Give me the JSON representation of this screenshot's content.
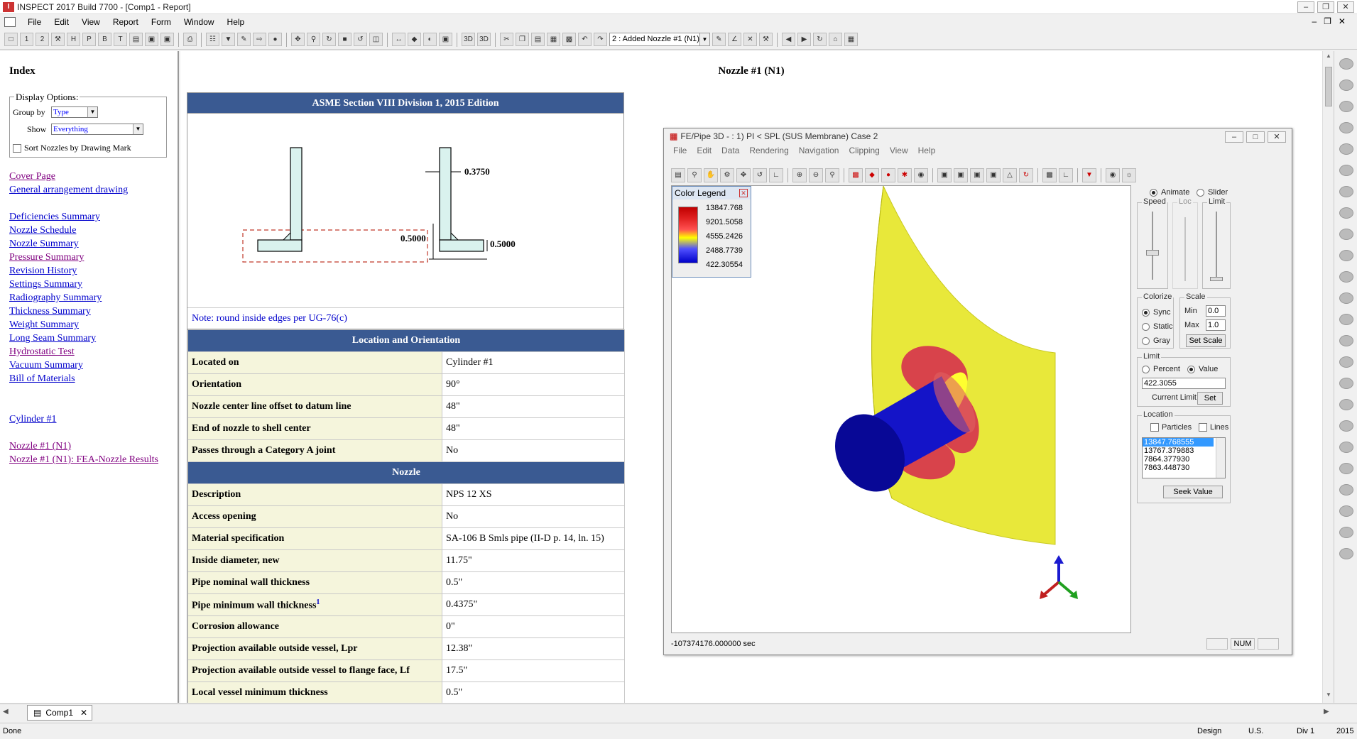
{
  "app": {
    "title": "INSPECT 2017 Build 7700 - [Comp1 - Report]",
    "menu": [
      "File",
      "Edit",
      "View",
      "Report",
      "Form",
      "Window",
      "Help"
    ],
    "history_combo": "2 : Added Nozzle #1 (N1)",
    "toolbar_3d_a": "3D",
    "toolbar_3d_b": "3D"
  },
  "sidebar": {
    "heading": "Index",
    "display_options": "Display Options:",
    "group_by_label": "Group by",
    "group_by_value": "Type",
    "show_label": "Show",
    "show_value": "Everything",
    "sort_label": "Sort Nozzles by Drawing Mark",
    "links": [
      "Cover Page",
      "General arrangement drawing",
      "Deficiencies Summary",
      "Nozzle Schedule",
      "Nozzle Summary",
      "Pressure Summary",
      "Revision History",
      "Settings Summary",
      "Radiography Summary",
      "Thickness Summary",
      "Weight Summary",
      "Long Seam Summary",
      "Hydrostatic Test",
      "Vacuum Summary",
      "Bill of Materials",
      "Cylinder #1",
      "Nozzle #1 (N1)",
      "Nozzle #1 (N1): FEA-Nozzle Results"
    ]
  },
  "report": {
    "title": "Nozzle #1 (N1)",
    "asme_header": "ASME Section VIII Division 1, 2015 Edition",
    "dims": {
      "top": "0.3750",
      "left": "0.5000",
      "right": "0.5000"
    },
    "note": "Note: round inside edges per UG-76(c)",
    "location_header": "Location and Orientation",
    "location_rows": [
      {
        "label": "Located on",
        "value": "Cylinder #1"
      },
      {
        "label": "Orientation",
        "value": "90°"
      },
      {
        "label": "Nozzle center line offset to datum line",
        "value": "48\""
      },
      {
        "label": "End of nozzle to shell center",
        "value": "48\""
      },
      {
        "label": "Passes through a Category A joint",
        "value": "No"
      }
    ],
    "nozzle_header": "Nozzle",
    "nozzle_rows": [
      {
        "label": "Description",
        "value": "NPS 12 XS"
      },
      {
        "label": "Access opening",
        "value": "No"
      },
      {
        "label": "Material specification",
        "value": "SA-106 B Smls pipe (II-D p. 14, ln. 15)"
      },
      {
        "label": "Inside diameter, new",
        "value": "11.75\""
      },
      {
        "label": "Pipe nominal wall thickness",
        "value": "0.5\""
      },
      {
        "label": "Pipe minimum wall thickness",
        "value": "0.4375\"",
        "sup": "1"
      },
      {
        "label": "Corrosion allowance",
        "value": "0\""
      },
      {
        "label": "Projection available outside vessel, Lpr",
        "value": "12.38\""
      },
      {
        "label": "Projection available outside vessel to flange face, Lf",
        "value": "17.5\""
      },
      {
        "label": "Local vessel minimum thickness",
        "value": "0.5\""
      }
    ]
  },
  "fe_window": {
    "title": "FE/Pipe 3D -  :      1) PI < SPL (SUS Membrane) Case 2",
    "menu": [
      "File",
      "Edit",
      "Data",
      "Rendering",
      "Navigation",
      "Clipping",
      "View",
      "Help"
    ],
    "legend_title": "Color Legend",
    "legend_values": [
      "13847.768",
      "9201.5058",
      "4555.2426",
      "2488.7739",
      "422.30554"
    ],
    "animate": "Animate",
    "slider": "Slider",
    "speed": "Speed",
    "loc": "Loc",
    "limit_lbl": "Limit",
    "colorize": "Colorize",
    "sync": "Sync",
    "static": "Static",
    "gray": "Gray",
    "scale": "Scale",
    "min_lbl": "Min",
    "min_val": "0.0",
    "max_lbl": "Max",
    "max_val": "1.0",
    "set_scale": "Set Scale",
    "limit_group": "Limit",
    "percent": "Percent",
    "value": "Value",
    "limit_val": "422.3055",
    "current_limit": "Current Limit",
    "set": "Set",
    "location": "Location",
    "particles": "Particles",
    "lines": "Lines",
    "location_list": [
      "13847.768555",
      "13767.379883",
      "7864.377930",
      "7863.448730"
    ],
    "seek": "Seek Value",
    "status_time": "-107374176.000000 sec",
    "num": "NUM"
  },
  "tab": "Comp1",
  "status": {
    "left": "Done",
    "mode": "Design",
    "units": "U.S.",
    "div": "Div 1",
    "year": "2015"
  }
}
